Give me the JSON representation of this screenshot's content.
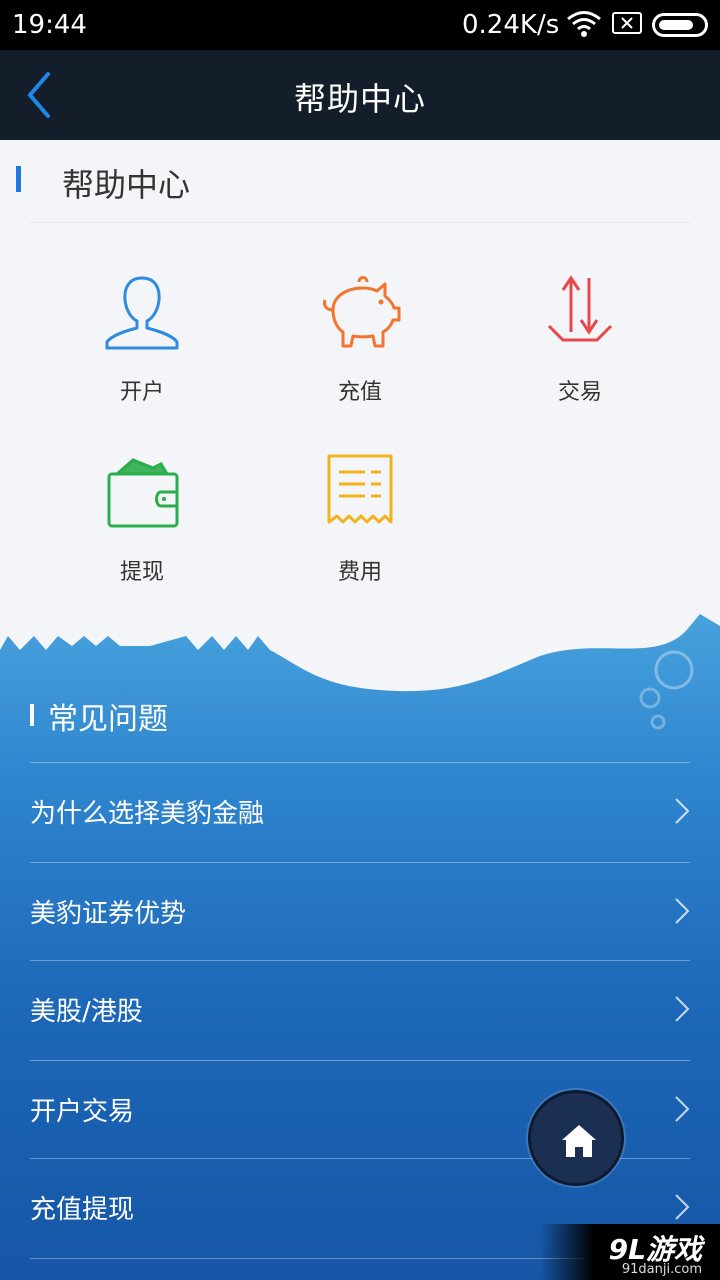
{
  "status_bar": {
    "time": "19:44",
    "net_speed": "0.24K/s"
  },
  "nav": {
    "title": "帮助中心"
  },
  "help": {
    "section_title": "帮助中心",
    "categories": [
      {
        "label": "开户",
        "icon": "user-icon",
        "color": "#2f8be0"
      },
      {
        "label": "充值",
        "icon": "piggy-bank-icon",
        "color": "#f4742d"
      },
      {
        "label": "交易",
        "icon": "transfer-arrows-icon",
        "color": "#e8474c"
      },
      {
        "label": "提现",
        "icon": "wallet-icon",
        "color": "#2aae4a"
      },
      {
        "label": "费用",
        "icon": "receipt-icon",
        "color": "#f2b21b"
      }
    ]
  },
  "faq": {
    "title": "常见问题",
    "items": [
      {
        "label": "为什么选择美豹金融"
      },
      {
        "label": "美豹证券优势"
      },
      {
        "label": "美股/港股"
      },
      {
        "label": "开户交易"
      },
      {
        "label": "充值提现"
      }
    ]
  },
  "watermark": {
    "brand": "9L游戏",
    "site": "91danji.com"
  },
  "colors": {
    "nav_bg": "#141e2b",
    "accent": "#1e78e0",
    "faq_bg_top": "#49a3dd",
    "faq_bg_bottom": "#1656a6"
  }
}
